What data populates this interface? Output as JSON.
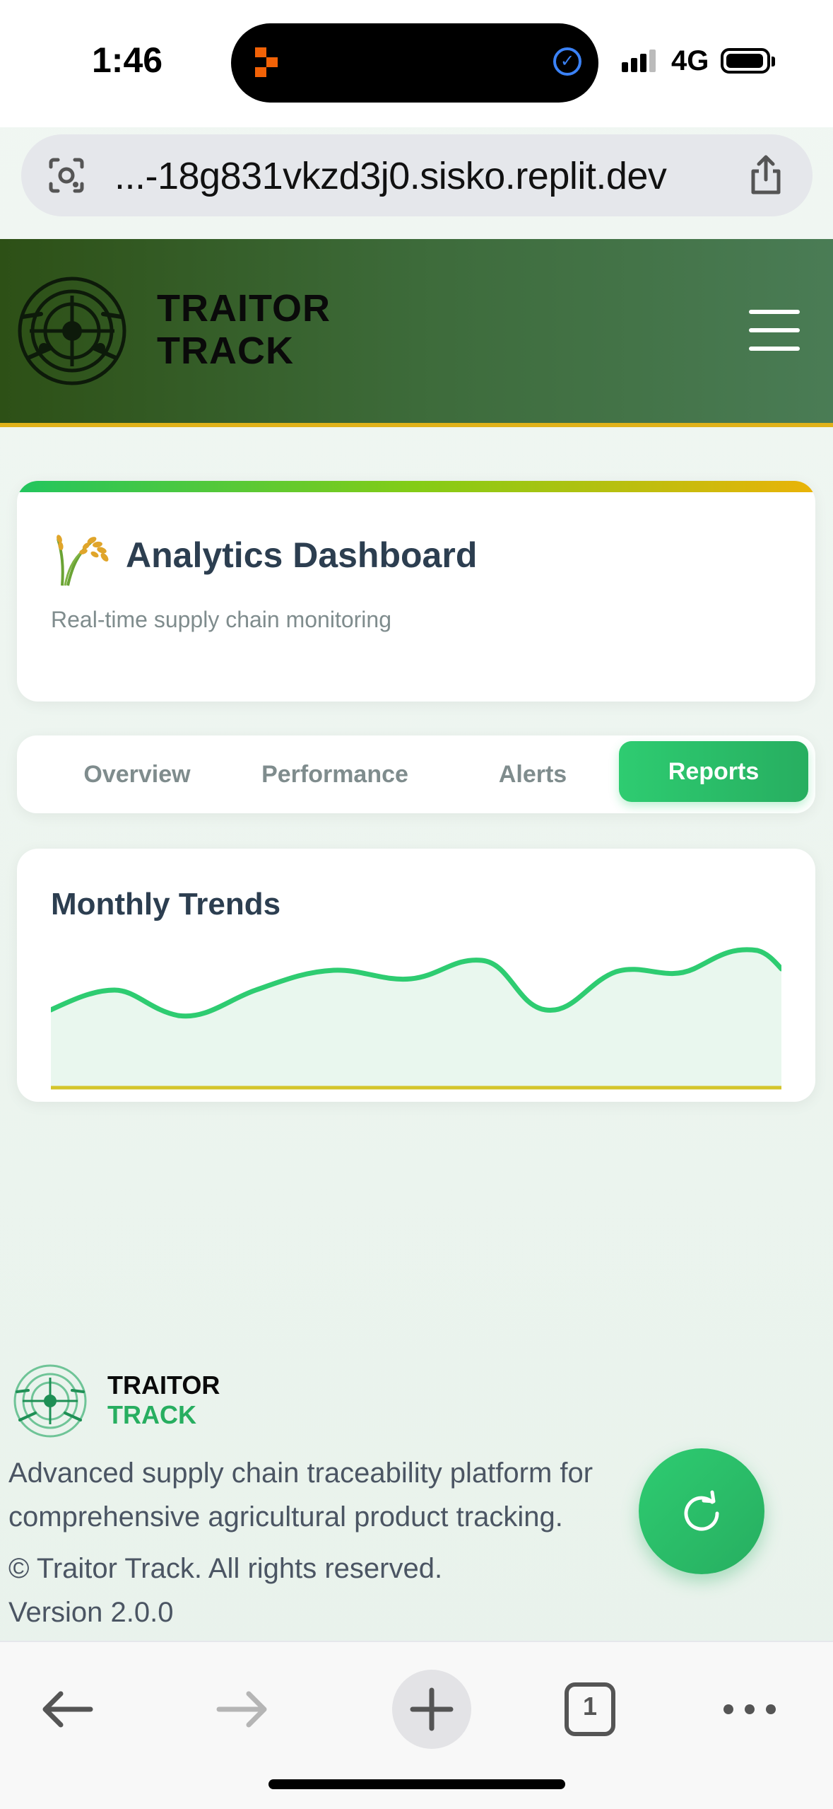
{
  "status_bar": {
    "time": "1:46",
    "network": "4G"
  },
  "browser": {
    "url": "...-18g831vkzd3j0.sisko.replit.dev",
    "tab_count": "1"
  },
  "header": {
    "brand_line1": "TRAITOR",
    "brand_line2": "TRACK"
  },
  "hero": {
    "title": "Analytics Dashboard",
    "subtitle": "Real-time supply chain monitoring"
  },
  "tabs": [
    {
      "label": "Overview",
      "active": false
    },
    {
      "label": "Performance",
      "active": false
    },
    {
      "label": "Alerts",
      "active": false
    },
    {
      "label": "Reports",
      "active": true
    }
  ],
  "trends": {
    "title": "Monthly Trends"
  },
  "footer": {
    "brand_line1": "TRAITOR",
    "brand_line2": "TRACK",
    "description": "Advanced supply chain traceability platform for comprehensive agricultural product tracking.",
    "copyright": "© Traitor Track. All rights reserved.",
    "version": "Version 2.0.0"
  },
  "colors": {
    "accent": "#27ae60",
    "header_dark": "#2d5016",
    "header_light": "#4a7c55",
    "gold": "#e0b21a"
  },
  "icons": [
    "camera-lens-icon",
    "share-icon",
    "menu-icon",
    "wheat-icon",
    "refresh-icon",
    "back-icon",
    "forward-icon",
    "plus-icon",
    "tabs-icon",
    "more-icon"
  ]
}
